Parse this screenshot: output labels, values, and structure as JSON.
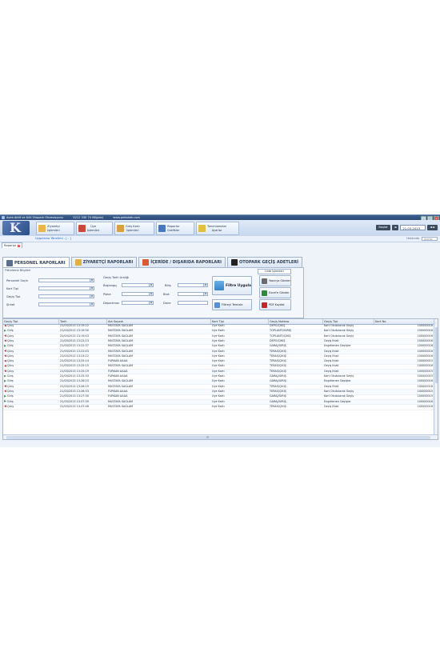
{
  "window": {
    "title": "Avea Aktif ve Kilit Otopark Otomasyonu",
    "phone": "0212 330 74 88(pbx)",
    "website": "www.pelkotek.com"
  },
  "toolbar": {
    "buttons": [
      {
        "label": "Ziyaretçi\nİşlemleri",
        "icon": "visitor-icon"
      },
      {
        "label": "Üye\nİşlemleri",
        "icon": "member-icon"
      },
      {
        "label": "Giriş Kartı\nİşlemleri",
        "icon": "card-icon"
      },
      {
        "label": "Raporlar\nGrafikler",
        "icon": "report-icon"
      },
      {
        "label": "Tanımlamalar\nAyarlar",
        "icon": "settings-icon"
      }
    ],
    "login_label": "Başlat",
    "date": "21.03.2013",
    "nav_label": "◄ ►"
  },
  "breadcrumb": {
    "link": "Uygulama Yönetimi - [ - ]",
    "favorites": "Hakkında",
    "search_placeholder": "Arama"
  },
  "doc_tab": {
    "label": "Raporlar"
  },
  "report_tabs": [
    {
      "label": "PERSONEL RAPORLARI",
      "icon": "personnel-icon"
    },
    {
      "label": "ZİYARETÇİ RAPORLARI",
      "icon": "visitor-report-icon"
    },
    {
      "label": "İÇERİDE / DIŞARIDA RAPORLARI",
      "icon": "inside-outside-icon"
    },
    {
      "label": "OTOPARK GEÇİŞ ADETLERİ",
      "icon": "parking-count-icon"
    }
  ],
  "filter": {
    "header": "Filtreleme Bilgileri",
    "fields": {
      "personnel": "Personeli Seçin",
      "card_type": "Kart Tipi",
      "pass_type": "Geçiş Tipi",
      "company": "Şirket",
      "date_range": "Geçiş Tarih Aralığı",
      "start": "Başlangıç",
      "end": "Bitiş",
      "plate": "Plaka",
      "block": "Blok",
      "department": "Departman",
      "flat": "Daire"
    },
    "apply_label": "Filtre Uygula",
    "clear_label": "Filtreyi Temizle",
    "list_ops": "Liste İşlemleri",
    "print_label": "Yazıcıya Gönder",
    "excel_label": "Excel'e Gönder",
    "pdf_label": "PDF Kaydet"
  },
  "grid": {
    "columns": [
      "Geçiş Tipi",
      "Tarih",
      "Adı Soyadı",
      "Kart Tipi",
      "Geçiş Noktası",
      "Geçiş Tipi",
      "Kart No"
    ],
    "rows": [
      [
        "Çıkış",
        "21/03/2013 13:19:22",
        "MUSTAFA SAĞLAM",
        "Üye Kartı",
        "DEPO/ÇIKIŞ",
        "Kart Okutularak Geçiş",
        "100000016"
      ],
      [
        "Giriş",
        "21/03/2013 13:19:30",
        "MUSTAFA SAĞLAM",
        "Üye Kartı",
        "TOPLANTI/GİRİŞ",
        "Kart Okutularak Geçiş",
        "100000016"
      ],
      [
        "Çıkış",
        "21/03/2013 13:19:43",
        "MUSTAFA SAĞLAM",
        "Üye Kartı",
        "TOPLANTI/ÇIKIŞ",
        "Kart Okutularak Geçiş",
        "100000016"
      ],
      [
        "Çıkış",
        "21/03/2013 13:22:23",
        "MUSTAFA SAĞLAM",
        "Üye Kartı",
        "DEPO/ÇIKIŞ",
        "Geçiş İhlali",
        "100000016"
      ],
      [
        "Giriş",
        "21/03/2013 13:22:37",
        "MUSTAFA SAĞLAM",
        "Üye Kartı",
        "GARAJ/GİRİŞ",
        "Engellenen Geçişler",
        "100000016"
      ],
      [
        "Çıkış",
        "21/03/2013 13:22:43",
        "MUSTAFA SAĞLAM",
        "Üye Kartı",
        "TERAS/ÇIKIŞ",
        "Geçiş İhlali",
        "100000016"
      ],
      [
        "Çıkış",
        "21/03/2013 13:23:22",
        "MUSTAFA SAĞLAM",
        "Üye Kartı",
        "TERAS/ÇIKIŞ",
        "Geçiş İhlali",
        "100000016"
      ],
      [
        "Çıkış",
        "21/03/2013 13:25:14",
        "FURKAN AAAA",
        "Üye Kartı",
        "TERAS/ÇIKIŞ",
        "Geçiş İhlali",
        "100000015"
      ],
      [
        "Çıkış",
        "21/03/2013 13:25:15",
        "MUSTAFA SAĞLAM",
        "Üye Kartı",
        "TERAS/ÇIKIŞ",
        "Geçiş İhlali",
        "100000016"
      ],
      [
        "Çıkış",
        "21/03/2013 13:25:19",
        "FURKAN AAAA",
        "Üye Kartı",
        "TERAS/ÇIKIŞ",
        "Geçiş İhlali",
        "100000015"
      ],
      [
        "Giriş",
        "21/03/2013 13:25:33",
        "FURKAN AAAA",
        "Üye Kartı",
        "GARAJ/GİRİŞ",
        "Kart Okutularak Geçiş",
        "100000015"
      ],
      [
        "Giriş",
        "21/03/2013 13:26:23",
        "MUSTAFA SAĞLAM",
        "Üye Kartı",
        "GARAJ/GİRİŞ",
        "Engellenen Geçişler",
        "100000016"
      ],
      [
        "Çıkış",
        "21/03/2013 13:26:19",
        "MUSTAFA SAĞLAM",
        "Üye Kartı",
        "TERAS/ÇIKIŞ",
        "Geçiş İhlali",
        "100000016"
      ],
      [
        "Çıkış",
        "21/03/2013 13:26:33",
        "FURKAN AAAA",
        "Üye Kartı",
        "TERAS/ÇIKIŞ",
        "Kart Okutularak Geçiş",
        "100000015"
      ],
      [
        "Giriş",
        "21/03/2013 13:27:30",
        "FURKAN AAAA",
        "Üye Kartı",
        "GARAJ/GİRİŞ",
        "Kart Okutularak Geçiş",
        "100000015"
      ],
      [
        "Giriş",
        "21/03/2013 13:27:39",
        "MUSTAFA SAĞLAM",
        "Üye Kartı",
        "GARAJ/GİRİŞ",
        "Engellenen Geçişler",
        "100000016"
      ],
      [
        "Çıkış",
        "21/03/2013 13:27:48",
        "MUSTAFA SAĞLAM",
        "Üye Kartı",
        "TERAS/ÇIKIŞ",
        "Geçiş İhlali",
        "100000016"
      ]
    ]
  },
  "colors": {
    "titlebar": "#2b4a78",
    "exit_arrow": "#d33a3a",
    "enter_arrow": "#3aa04a"
  }
}
